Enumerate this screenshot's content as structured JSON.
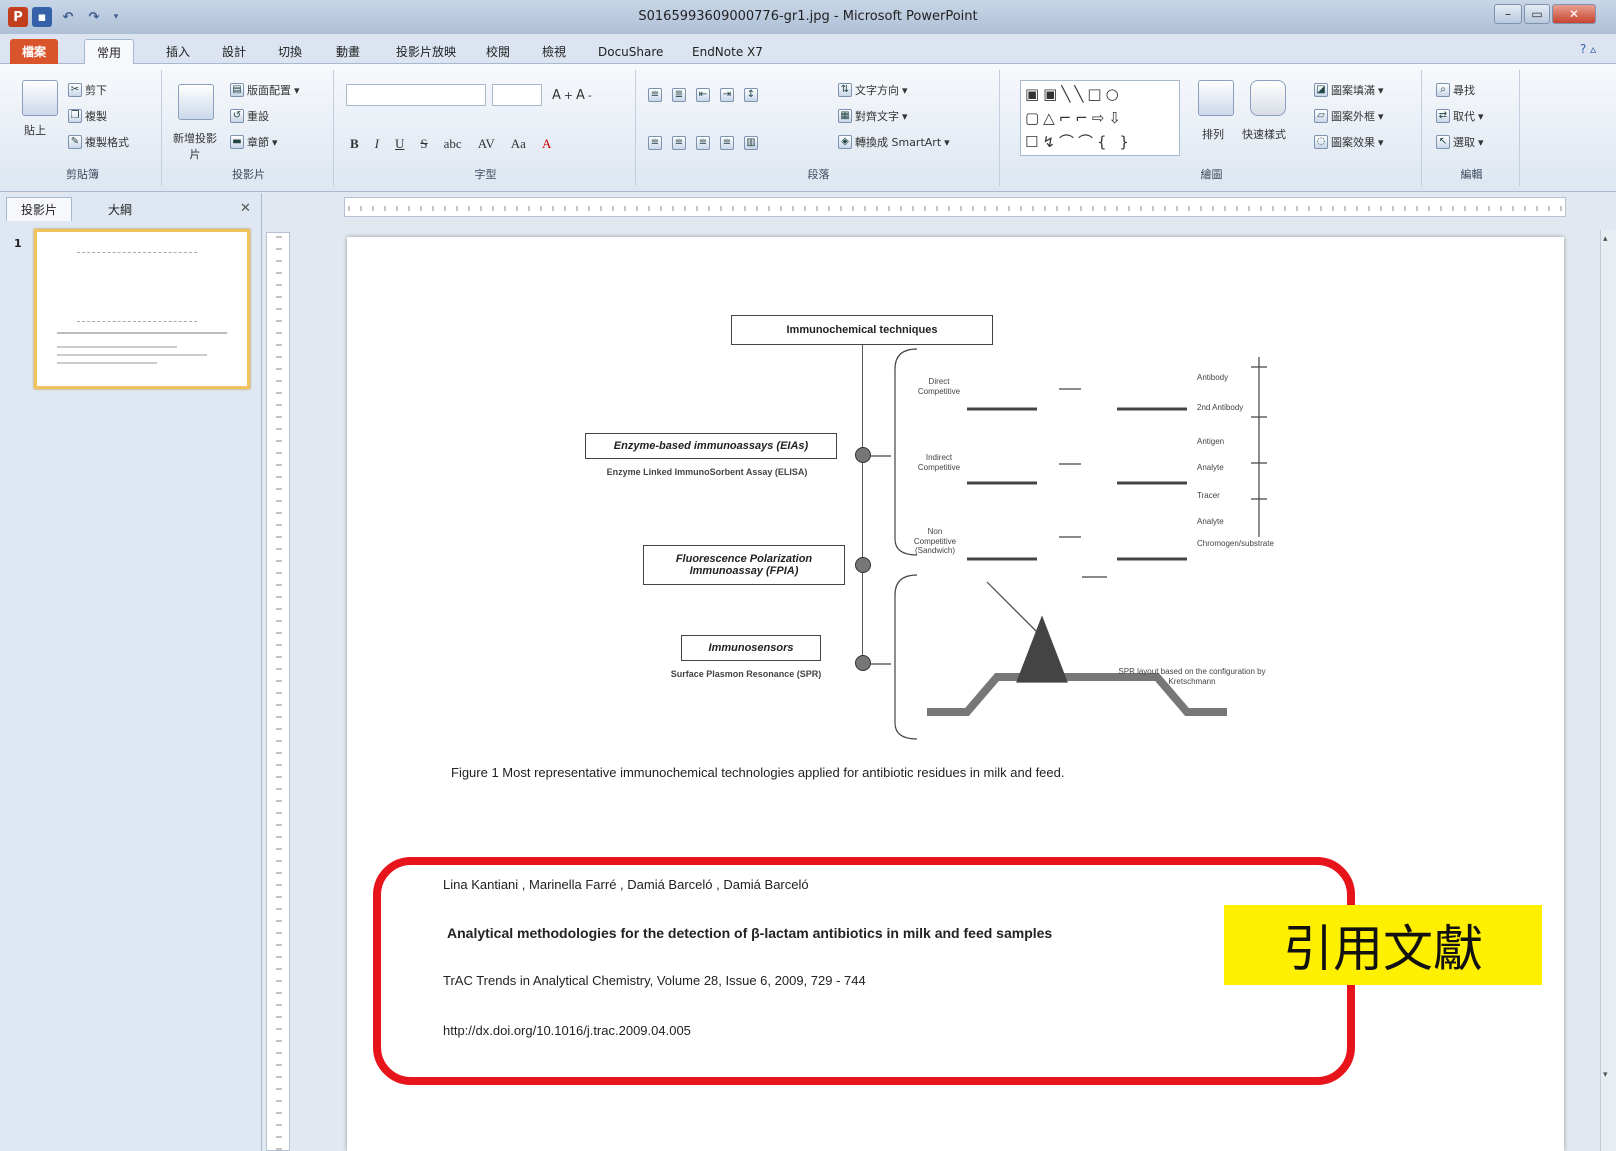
{
  "window": {
    "title": "S0165993609000776-gr1.jpg - Microsoft PowerPoint",
    "qat_icons": [
      "powerpoint-icon",
      "save-icon",
      "undo-icon",
      "redo-icon",
      "customize-icon"
    ]
  },
  "tabs": [
    "檔案",
    "常用",
    "插入",
    "設計",
    "切換",
    "動畫",
    "投影片放映",
    "校閱",
    "檢視",
    "DocuShare",
    "EndNote X7"
  ],
  "ribbon": {
    "clipboard": {
      "label": "剪貼簿",
      "paste": "貼上",
      "cut": "剪下",
      "copy": "複製",
      "format_painter": "複製格式"
    },
    "slides": {
      "label": "投影片",
      "new_slide": "新增投影片",
      "layout": "版面配置",
      "reset": "重設",
      "section": "章節"
    },
    "font": {
      "label": "字型"
    },
    "paragraph": {
      "label": "段落",
      "text_direction": "文字方向",
      "align_text": "對齊文字",
      "smartart": "轉換成 SmartArt"
    },
    "drawing": {
      "label": "繪圖",
      "arrange": "排列",
      "quick_styles": "快速樣式",
      "shape_fill": "圖案填滿",
      "shape_outline": "圖案外框",
      "shape_effects": "圖案效果"
    },
    "editing": {
      "label": "編輯",
      "find": "尋找",
      "replace": "取代",
      "select": "選取"
    }
  },
  "left_pane": {
    "tab_slides": "投影片",
    "tab_outline": "大綱",
    "slide_number": "1"
  },
  "figure": {
    "title": "Immunochemical techniques",
    "eia_title": "Enzyme-based immunoassays (EIAs)",
    "eia_sub": "Enzyme Linked ImmunoSorbent Assay (ELISA)",
    "fpia_line1": "Fluorescence Polarization",
    "fpia_line2": "Immunoassay (FPIA)",
    "sensor_title": "Immunosensors",
    "sensor_sub": "Surface Plasmon Resonance (SPR)",
    "direct": "Direct Competitive",
    "indirect": "Indirect Competitive",
    "noncomp": "Non Competitive (Sandwich)",
    "legend": [
      "Antibody",
      "2nd Antibody",
      "Antigen",
      "Analyte",
      "Tracer",
      "Analyte",
      "Chromogen/substrate"
    ],
    "spr_note": "SPR layout based on the configuration by Kretschmann",
    "caption": "Figure 1 Most representative  immunochemical technologies applied for antibiotic residues in milk and feed."
  },
  "reference": {
    "authors": "Lina  Kantiani , Marinella  Farré  , Damiá  Barceló , Damiá  Barceló",
    "title": "Analytical methodologies for the detection of β-lactam antibiotics in milk and feed samples",
    "journal": "TrAC  Trends  in Analytical Chemistry,  Volume 28, Issue 6, 2009,  729 - 744",
    "doi": "http://dx.doi.org/10.1016/j.trac.2009.04.005",
    "callout": "引用文獻"
  },
  "colors": {
    "highlight_border": "#e8141b",
    "callout_bg": "#ffef00",
    "file_tab": "#d9542b"
  }
}
